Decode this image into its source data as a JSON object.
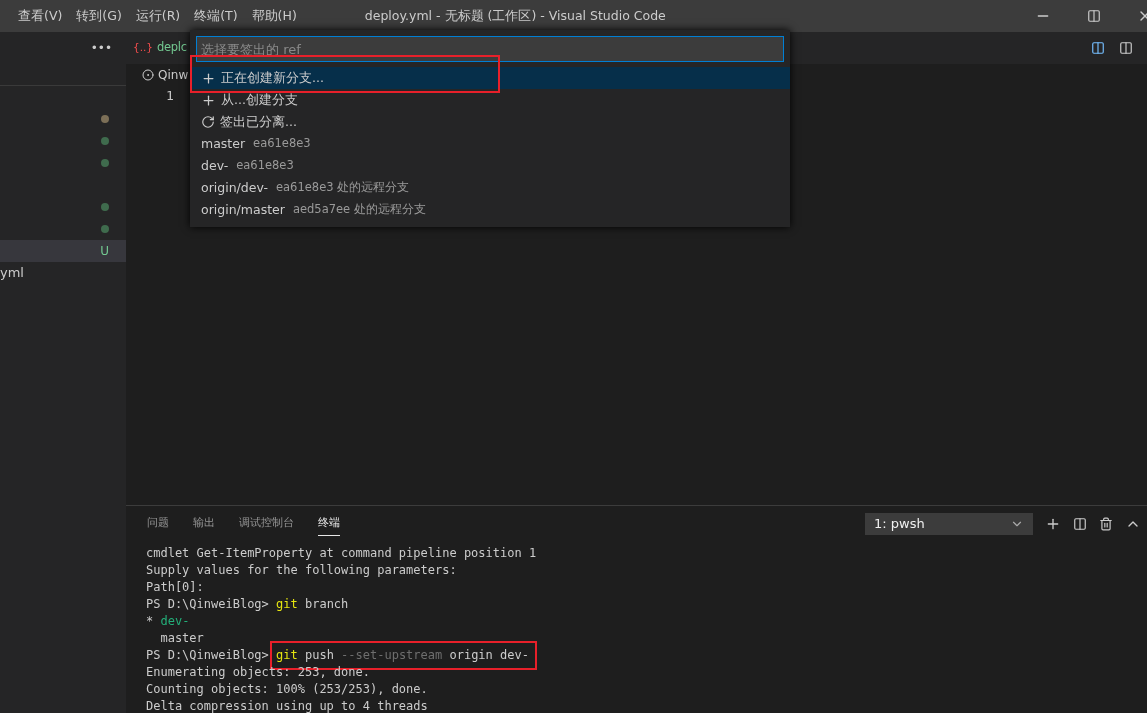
{
  "menu": [
    "查看(V)",
    "转到(G)",
    "运行(R)",
    "终端(T)",
    "帮助(H)"
  ],
  "window": {
    "title": "deploy.yml - 无标题 (工作区) - Visual Studio Code"
  },
  "sidebar": {
    "more": "•••",
    "groups": [
      {
        "items": [
          {
            "color": "#7c6f57",
            "selected": false
          },
          {
            "color": "#3f6b4d",
            "selected": false
          },
          {
            "color": "#3f6b4d",
            "selected": false
          }
        ]
      },
      {
        "items": [
          {
            "color": "#3f6b4d",
            "selected": false
          },
          {
            "color": "#3f6b4d",
            "selected": false
          },
          {
            "badge": "U",
            "selected": true
          },
          {
            "label": "yml",
            "selected": false
          }
        ]
      }
    ]
  },
  "editor": {
    "tab": {
      "icon": "{..}",
      "label": "deplc"
    },
    "breadcrumb": "Qinw",
    "line_numbers": [
      "1"
    ]
  },
  "quick_pick": {
    "placeholder": "选择要签出的 ref",
    "items": [
      {
        "kind": "create",
        "label": "正在创建新分支...",
        "selected": true,
        "highlighted": true
      },
      {
        "kind": "create",
        "label": "从...创建分支",
        "selected": false,
        "highlighted": false
      },
      {
        "kind": "detach",
        "label": "签出已分离...",
        "selected": false,
        "highlighted": false
      },
      {
        "kind": "ref",
        "label": "master",
        "detail": "ea61e8e3",
        "selected": false,
        "highlighted": false
      },
      {
        "kind": "ref",
        "label": "dev-",
        "detail": "ea61e8e3",
        "selected": false,
        "highlighted": false
      },
      {
        "kind": "ref",
        "label": "origin/dev-",
        "detail": "ea61e8e3 处的远程分支",
        "selected": false,
        "highlighted": false
      },
      {
        "kind": "ref",
        "label": "origin/master",
        "detail": "aed5a7ee 处的远程分支",
        "selected": false,
        "highlighted": false
      }
    ]
  },
  "panel": {
    "tabs": [
      {
        "label": "问题",
        "selected": false
      },
      {
        "label": "输出",
        "selected": false
      },
      {
        "label": "调试控制台",
        "selected": false
      },
      {
        "label": "终端",
        "selected": true
      }
    ],
    "terminal_select": "1: pwsh",
    "lines": [
      {
        "highlighted": false,
        "segments": [
          {
            "kind": "plain",
            "text": "cmdlet Get-ItemProperty at command pipeline position 1"
          }
        ]
      },
      {
        "highlighted": false,
        "segments": [
          {
            "kind": "plain",
            "text": "Supply values for the following parameters:"
          }
        ]
      },
      {
        "highlighted": false,
        "segments": [
          {
            "kind": "plain",
            "text": "Path[0]:"
          }
        ]
      },
      {
        "highlighted": false,
        "segments": [
          {
            "kind": "plain",
            "text": "PS D:\\QinweiBlog> "
          },
          {
            "kind": "command",
            "text": "git"
          },
          {
            "kind": "plain",
            "text": " branch"
          }
        ]
      },
      {
        "highlighted": false,
        "segments": [
          {
            "kind": "plain",
            "text": "* "
          },
          {
            "kind": "current",
            "text": "dev-"
          }
        ]
      },
      {
        "highlighted": false,
        "segments": [
          {
            "kind": "plain",
            "text": "  master"
          }
        ]
      },
      {
        "highlighted": true,
        "segments": [
          {
            "kind": "plain",
            "text": "PS D:\\QinweiBlog> "
          },
          {
            "kind": "command",
            "text": "git"
          },
          {
            "kind": "plain",
            "text": " push "
          },
          {
            "kind": "option",
            "text": "--set-upstream"
          },
          {
            "kind": "plain",
            "text": " origin dev-"
          }
        ]
      },
      {
        "highlighted": false,
        "segments": [
          {
            "kind": "plain",
            "text": "Enumerating objects: 253, done."
          }
        ]
      },
      {
        "highlighted": false,
        "segments": [
          {
            "kind": "plain",
            "text": "Counting objects: 100% (253/253), done."
          }
        ]
      },
      {
        "highlighted": false,
        "segments": [
          {
            "kind": "plain",
            "text": "Delta compression using up to 4 threads"
          }
        ]
      }
    ]
  }
}
